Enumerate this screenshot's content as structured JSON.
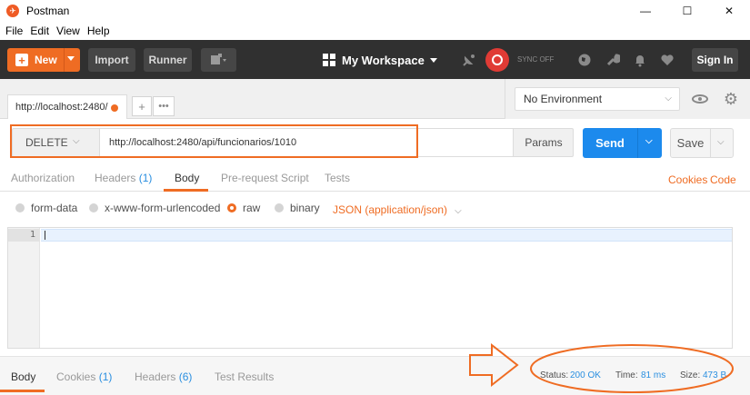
{
  "window": {
    "title": "Postman",
    "controls": [
      "—",
      "☐",
      "✕"
    ]
  },
  "menu": [
    "File",
    "Edit",
    "View",
    "Help"
  ],
  "header": {
    "new_label": "New",
    "import_label": "Import",
    "runner_label": "Runner",
    "workspace_label": "My Workspace",
    "sync_label": "SYNC OFF",
    "signin_label": "Sign In"
  },
  "tabs": {
    "request_tab_label": "http://localhost:2480/",
    "add_label": "+",
    "more_label": "•••"
  },
  "environment": {
    "selected": "No Environment"
  },
  "request": {
    "method": "DELETE",
    "url": "http://localhost:2480/api/funcionarios/1010",
    "params_label": "Params",
    "send_label": "Send",
    "save_label": "Save"
  },
  "request_tabs": [
    {
      "label": "Authorization",
      "count": ""
    },
    {
      "label": "Headers",
      "count": "(1)"
    },
    {
      "label": "Body",
      "count": ""
    },
    {
      "label": "Pre-request Script",
      "count": ""
    },
    {
      "label": "Tests",
      "count": ""
    }
  ],
  "links": {
    "cookies": "Cookies",
    "code": "Code"
  },
  "body_types": [
    {
      "label": "form-data",
      "selected": false
    },
    {
      "label": "x-www-form-urlencoded",
      "selected": false
    },
    {
      "label": "raw",
      "selected": true
    },
    {
      "label": "binary",
      "selected": false
    }
  ],
  "raw_type": "JSON (application/json)",
  "editor": {
    "line_numbers": [
      "1"
    ]
  },
  "response_tabs": [
    {
      "label": "Body",
      "count": ""
    },
    {
      "label": "Cookies",
      "count": "(1)"
    },
    {
      "label": "Headers",
      "count": "(6)"
    },
    {
      "label": "Test Results",
      "count": ""
    }
  ],
  "response_stats": {
    "status_label": "Status:",
    "status_value": "200 OK",
    "time_label": "Time:",
    "time_value": "81 ms",
    "size_label": "Size:",
    "size_value": "473 B"
  },
  "colors": {
    "accent": "#ef6c23",
    "primary": "#1c8aed",
    "header_bg": "#303030",
    "annotation": "#ef6c23"
  }
}
